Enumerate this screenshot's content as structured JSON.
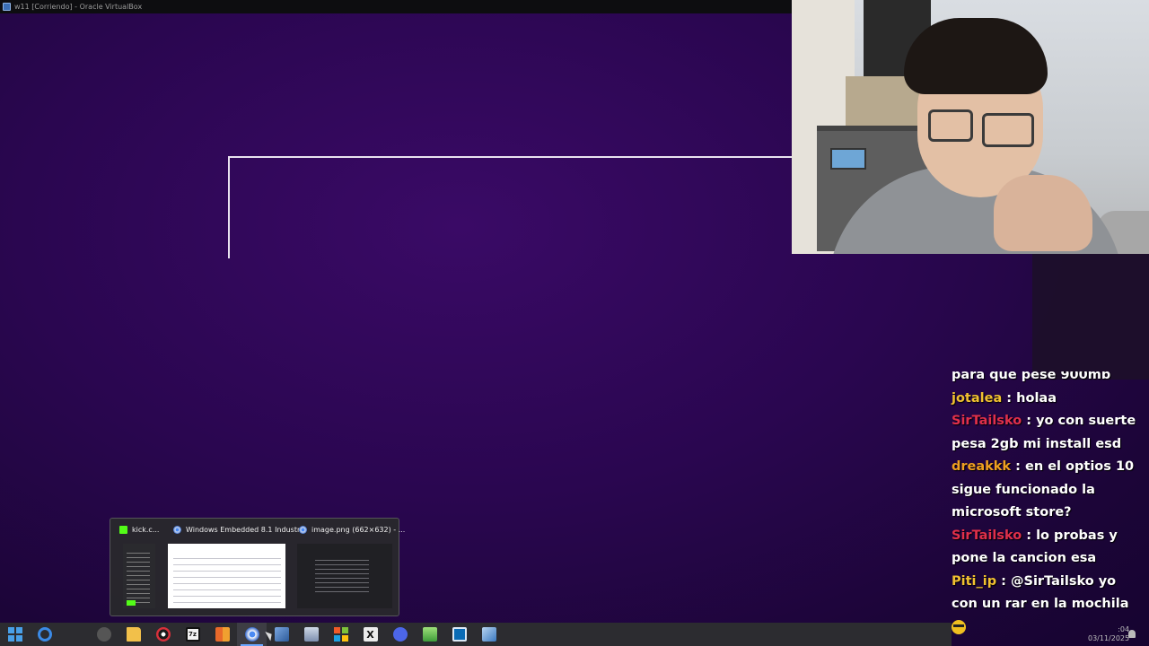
{
  "window": {
    "title": "w11 [Corriendo] - Oracle VirtualBox"
  },
  "chat": {
    "messages": [
      {
        "user": "",
        "user_color": "#ffffff",
        "text": "para que pese 900mb"
      },
      {
        "user": "jotalea",
        "user_color": "#f0c030",
        "text": "holaa"
      },
      {
        "user": "SirTailsko",
        "user_color": "#e0304a",
        "text": "yo con suerte pesa 2gb mi install esd"
      },
      {
        "user": "dreakkk",
        "user_color": "#f0a020",
        "text": "en el optios 10 sigue funcionado la microsoft store?"
      },
      {
        "user": "SirTailsko",
        "user_color": "#e0304a",
        "text": "lo probas y pone la cancion esa"
      },
      {
        "user": "Piti_ip",
        "user_color": "#f0c030",
        "text": "@SirTailsko yo con un rar en la mochila"
      }
    ]
  },
  "taskbar_preview": {
    "thumbnails": [
      {
        "title": "kick.c...",
        "icon": "kick-icon"
      },
      {
        "title": "Windows Embedded 8.1 Industr...",
        "icon": "chrome-icon"
      },
      {
        "title": "image.png (662×632) - ...",
        "icon": "chrome-icon"
      }
    ]
  },
  "taskbar": {
    "items": [
      {
        "name": "start-button",
        "icon": "windows-start-icon"
      },
      {
        "name": "cortana-button",
        "icon": "cortana-icon"
      },
      {
        "name": "spider-app",
        "icon": "spider-icon"
      },
      {
        "name": "file-explorer",
        "icon": "folder-icon"
      },
      {
        "name": "obs-studio",
        "icon": "obs-icon"
      },
      {
        "name": "7zip",
        "icon": "7zip-icon",
        "label": "7z"
      },
      {
        "name": "office",
        "icon": "office-icon"
      },
      {
        "name": "chrome",
        "icon": "chrome-icon",
        "active": true
      },
      {
        "name": "virtualbox",
        "icon": "virtualbox-icon"
      },
      {
        "name": "mail",
        "icon": "mail-icon"
      },
      {
        "name": "windows-store",
        "icon": "windows-logo-icon"
      },
      {
        "name": "x-app",
        "icon": "x-icon",
        "label": "X"
      },
      {
        "name": "discord",
        "icon": "discord-icon"
      },
      {
        "name": "spreadsheet",
        "icon": "spreadsheet-icon"
      },
      {
        "name": "remote-desktop",
        "icon": "remote-desktop-icon"
      },
      {
        "name": "tools",
        "icon": "tools-icon"
      }
    ],
    "clock_time": ":04",
    "clock_date": "03/11/2025"
  },
  "colors": {
    "desktop_bg": "#2a0650",
    "taskbar_bg": "#2c2c30",
    "accent": "#6aa6ff"
  }
}
